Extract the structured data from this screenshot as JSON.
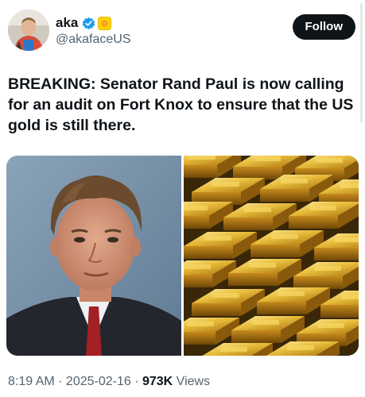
{
  "author": {
    "display_name": "aka",
    "handle": "@akafaceUS",
    "verified_badge_color": "#1d9bf0",
    "affiliate_badge_color": "#ffd400"
  },
  "follow_label": "Follow",
  "tweet_text": "BREAKING: Senator Rand Paul is now calling for an audit on Fort Knox to ensure that the US gold is still there.",
  "media": {
    "left_image": "portrait-photo",
    "right_image": "gold-bars-photo"
  },
  "meta": {
    "time": "8:19 AM",
    "separator": " · ",
    "date": "2025-02-16",
    "views_count": "973K",
    "views_label": " Views"
  },
  "colors": {
    "text_primary": "#0f1419",
    "text_secondary": "#536471",
    "button_bg": "#0f1419"
  }
}
